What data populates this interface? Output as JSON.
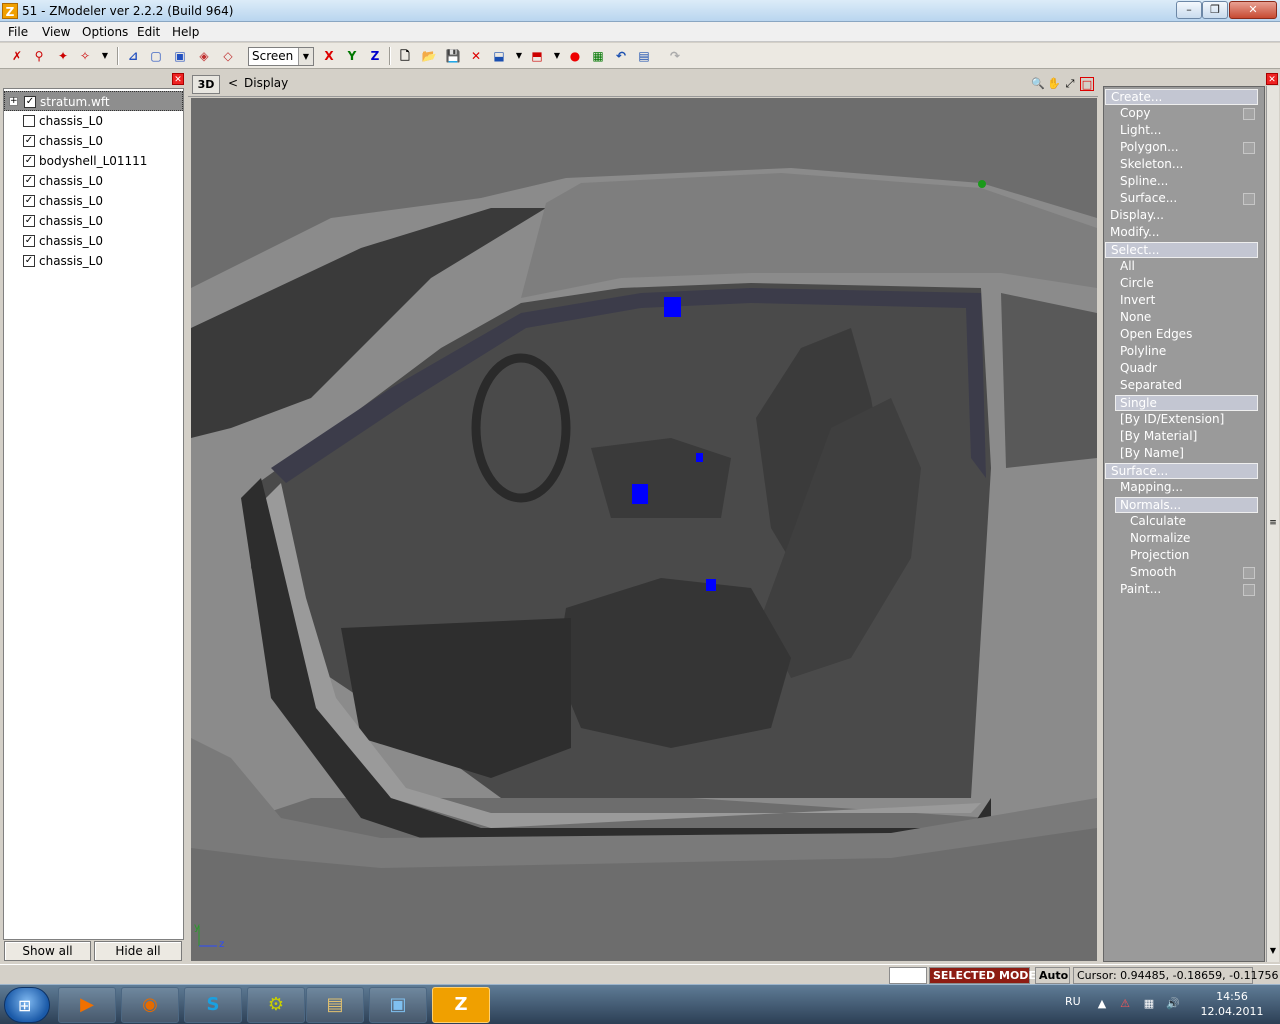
{
  "window": {
    "title": "51 - ZModeler ver 2.2.2 (Build 964)",
    "app_icon_letter": "Z",
    "min_glyph": "–",
    "max_glyph": "❐",
    "close_glyph": "✕"
  },
  "menu": [
    "File",
    "View",
    "Options",
    "Edit",
    "Help"
  ],
  "toolbar": {
    "screen_select": "Screen",
    "axis_x": "X",
    "axis_y": "Y",
    "axis_z": "Z"
  },
  "tree": {
    "items": [
      {
        "label": "stratum.wft",
        "checked": true,
        "expander": "+"
      },
      {
        "label": "chassis_L0",
        "checked": false
      },
      {
        "label": "chassis_L0",
        "checked": true
      },
      {
        "label": "bodyshell_L01111",
        "checked": true
      },
      {
        "label": "chassis_L0",
        "checked": true
      },
      {
        "label": "chassis_L0",
        "checked": true
      },
      {
        "label": "chassis_L0",
        "checked": true
      },
      {
        "label": "chassis_L0",
        "checked": true
      },
      {
        "label": "chassis_L0",
        "checked": true
      }
    ],
    "check_glyph": "✓",
    "show_all": "Show all",
    "hide_all": "Hide all",
    "close_glyph": "✕"
  },
  "viewport": {
    "mode": "3D",
    "chevron": "<",
    "label": "Display",
    "axis_y_label": "y",
    "axis_z_label": "z"
  },
  "commands": [
    {
      "label": "Create...",
      "type": "hdr",
      "indent": 0
    },
    {
      "label": "Copy",
      "type": "item",
      "indent": 1,
      "box": true
    },
    {
      "label": "Light...",
      "type": "item",
      "indent": 1
    },
    {
      "label": "Polygon...",
      "type": "item",
      "indent": 1,
      "box": true
    },
    {
      "label": "Skeleton...",
      "type": "item",
      "indent": 1
    },
    {
      "label": "Spline...",
      "type": "item",
      "indent": 1
    },
    {
      "label": "Surface...",
      "type": "item",
      "indent": 1,
      "box": true
    },
    {
      "label": "Display...",
      "type": "item",
      "indent": 0
    },
    {
      "label": "Modify...",
      "type": "item",
      "indent": 0
    },
    {
      "label": "Select...",
      "type": "hdr",
      "indent": 0
    },
    {
      "label": "All",
      "type": "item",
      "indent": 1
    },
    {
      "label": "Circle",
      "type": "item",
      "indent": 1
    },
    {
      "label": "Invert",
      "type": "item",
      "indent": 1
    },
    {
      "label": "None",
      "type": "item",
      "indent": 1
    },
    {
      "label": "Open Edges",
      "type": "item",
      "indent": 1
    },
    {
      "label": "Polyline",
      "type": "item",
      "indent": 1
    },
    {
      "label": "Quadr",
      "type": "item",
      "indent": 1
    },
    {
      "label": "Separated",
      "type": "item",
      "indent": 1
    },
    {
      "label": "Single",
      "type": "sel",
      "indent": 1
    },
    {
      "label": "[By ID/Extension]",
      "type": "item",
      "indent": 1
    },
    {
      "label": "[By Material]",
      "type": "item",
      "indent": 1
    },
    {
      "label": "[By Name]",
      "type": "item",
      "indent": 1
    },
    {
      "label": "Surface...",
      "type": "hdr",
      "indent": 0
    },
    {
      "label": "Mapping...",
      "type": "item",
      "indent": 1
    },
    {
      "label": "Normals...",
      "type": "sel",
      "indent": 1
    },
    {
      "label": "Calculate",
      "type": "item",
      "indent": 2
    },
    {
      "label": "Normalize",
      "type": "item",
      "indent": 2
    },
    {
      "label": "Projection",
      "type": "item",
      "indent": 2
    },
    {
      "label": "Smooth",
      "type": "item",
      "indent": 2,
      "box": true
    },
    {
      "label": "Paint...",
      "type": "item",
      "indent": 1,
      "box": true
    }
  ],
  "status": {
    "mode": "SELECTED MODE",
    "auto": "Auto",
    "cursor": "Cursor: 0.94485, -0.18659, -0.11756"
  },
  "taskbar": {
    "apps": [
      "▶",
      "◉",
      "S",
      "⚙",
      "▤",
      "▣",
      "Z"
    ],
    "lang": "RU",
    "time": "14:56",
    "date": "12.04.2011"
  },
  "colors": {
    "viewport_bg": "#6d6d6d",
    "selected_mode_bg": "#8d1c13",
    "command_bg": "#9a9a9a",
    "marker_blue": "#0000ff"
  }
}
